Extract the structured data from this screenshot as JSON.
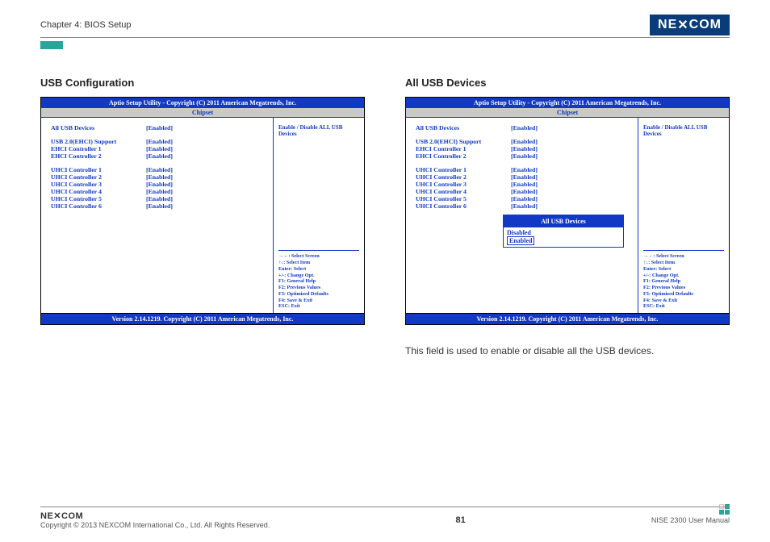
{
  "header": {
    "chapter": "Chapter 4: BIOS Setup",
    "brand": "NEXCOM"
  },
  "left": {
    "title": "USB Configuration",
    "bios": {
      "title": "Aptio Setup Utility - Copyright (C) 2011 American Megatrends, Inc.",
      "tab": "Chipset",
      "settings": [
        {
          "label": "All USB Devices",
          "value": "[Enabled]"
        },
        {
          "spacer": true
        },
        {
          "label": "USB 2.0(EHCI) Support",
          "value": "[Enabled]"
        },
        {
          "label": "EHCI Controller 1",
          "value": "[Enabled]"
        },
        {
          "label": "EHCI Controller 2",
          "value": "[Enabled]"
        },
        {
          "spacer": true
        },
        {
          "label": "UHCI Controller 1",
          "value": "[Enabled]"
        },
        {
          "label": "UHCI Controller 2",
          "value": "[Enabled]"
        },
        {
          "label": "UHCI Controller 3",
          "value": "[Enabled]"
        },
        {
          "label": "UHCI Controller 4",
          "value": "[Enabled]"
        },
        {
          "label": "UHCI Controller 5",
          "value": "[Enabled]"
        },
        {
          "label": "UHCI Controller 6",
          "value": "[Enabled]"
        }
      ],
      "help": "Enable / Disable ALL USB Devices",
      "hints": [
        "→←: Select Screen",
        "↑↓: Select Item",
        "Enter: Select",
        "+/-: Change Opt.",
        "F1: General Help",
        "F2: Previous Values",
        "F3: Optimized Defaults",
        "F4: Save & Exit",
        "ESC: Exit"
      ],
      "footer": "Version 2.14.1219. Copyright (C) 2011 American Megatrends, Inc."
    }
  },
  "right": {
    "title": "All USB Devices",
    "bios": {
      "title": "Aptio Setup Utility - Copyright (C) 2011 American Megatrends, Inc.",
      "tab": "Chipset",
      "settings": [
        {
          "label": "All USB Devices",
          "value": "[Enabled]"
        },
        {
          "spacer": true
        },
        {
          "label": "USB 2.0(EHCI) Support",
          "value": "[Enabled]"
        },
        {
          "label": "EHCI Controller 1",
          "value": "[Enabled]"
        },
        {
          "label": "EHCI Controller 2",
          "value": "[Enabled]"
        },
        {
          "spacer": true
        },
        {
          "label": "UHCI Controller 1",
          "value": "[Enabled]"
        },
        {
          "label": "UHCI Controller 2",
          "value": "[Enabled]"
        },
        {
          "label": "UHCI Controller 3",
          "value": "[Enabled]"
        },
        {
          "label": "UHCI Controller 4",
          "value": "[Enabled]"
        },
        {
          "label": "UHCI Controller 5",
          "value": "[Enabled]"
        },
        {
          "label": "UHCI Controller 6",
          "value": "[Enabled]"
        }
      ],
      "help": "Enable / Disable ALL USB Devices",
      "hints": [
        "→←: Select Screen",
        "↑↓: Select Item",
        "Enter: Select",
        "+/-: Change Opt.",
        "F1: General Help",
        "F2: Previous Values",
        "F3: Optimized Defaults",
        "F4: Save & Exit",
        "ESC: Exit"
      ],
      "footer": "Version 2.14.1219. Copyright (C) 2011 American Megatrends, Inc.",
      "popup": {
        "title": "All USB Devices",
        "options": [
          "Disabled",
          "Enabled"
        ],
        "selected": "Enabled"
      }
    },
    "description": "This field is used to enable or disable all the USB devices."
  },
  "footer": {
    "brand": "NEXCOM",
    "copyright": "Copyright © 2013 NEXCOM International Co., Ltd. All Rights Reserved.",
    "page": "81",
    "manual": "NISE 2300 User Manual"
  }
}
